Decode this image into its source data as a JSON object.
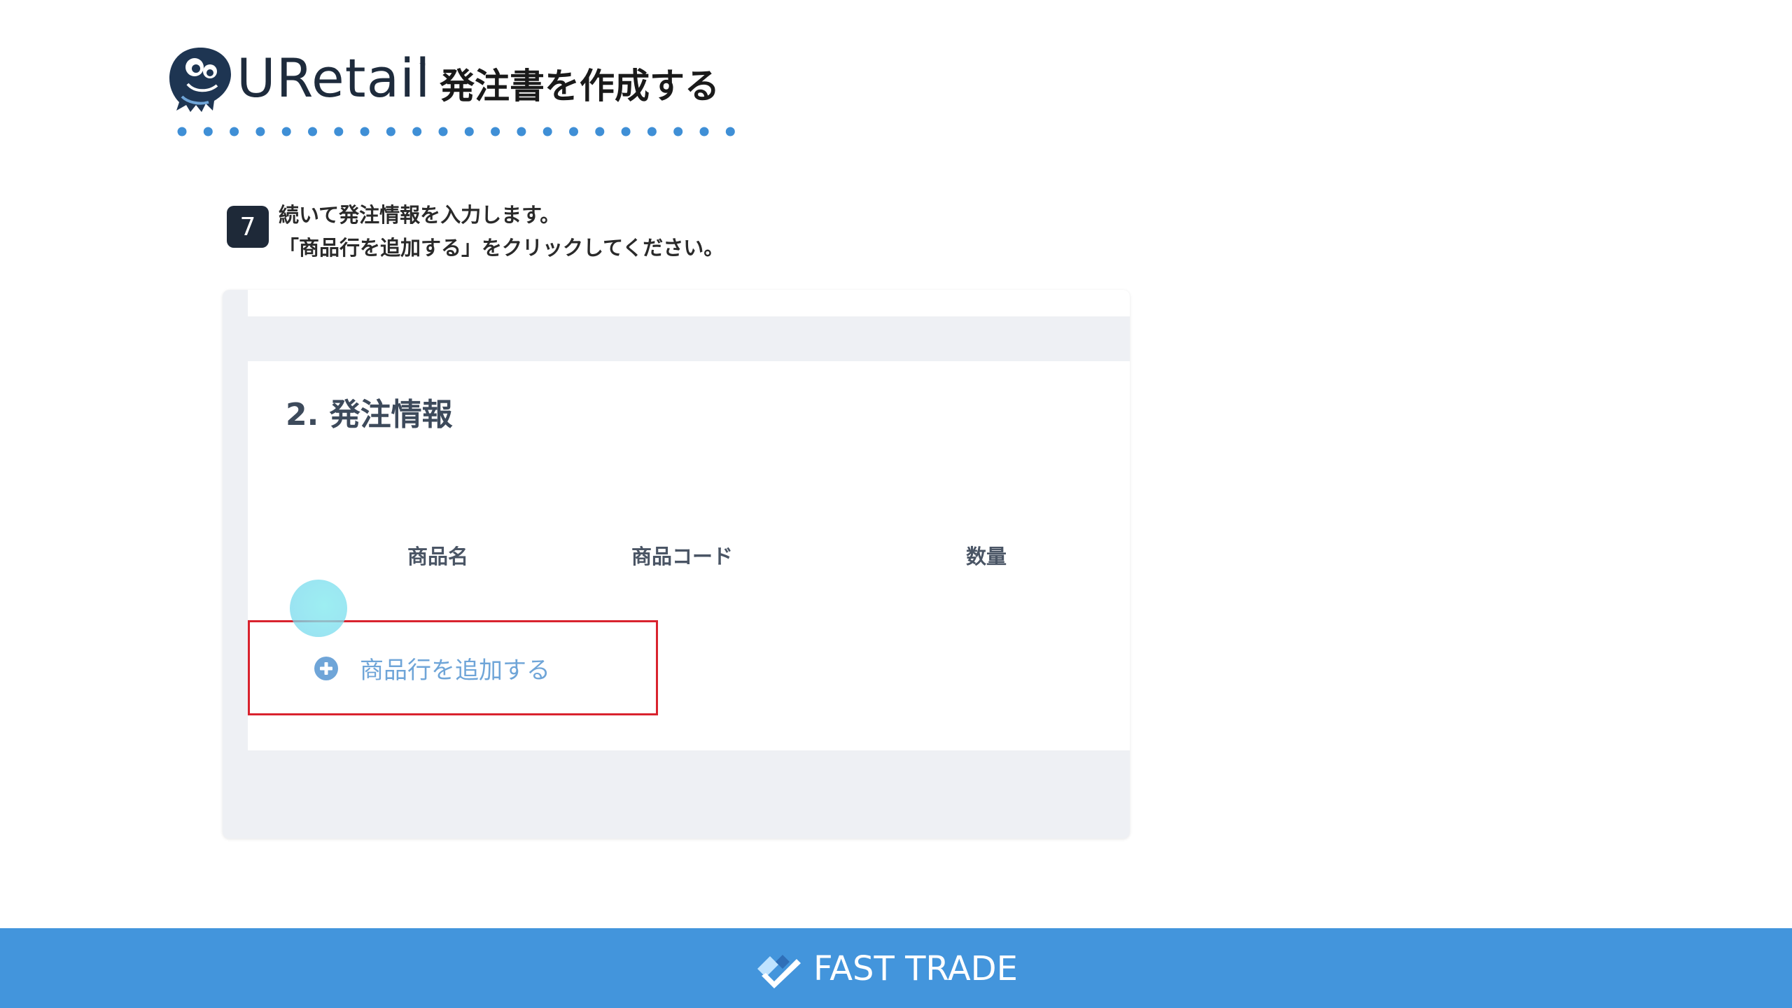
{
  "header": {
    "logo_text": "URetail",
    "logo_tm": "™",
    "title": "発注書を作成する"
  },
  "step": {
    "number": "7",
    "line1": "続いて発注情報を入力します。",
    "line2": "「商品行を追加する」をクリックしてください。"
  },
  "screenshot": {
    "section_title": "2. 発注情報",
    "columns": [
      "商品名",
      "商品コード",
      "数量"
    ],
    "add_row_label": "商品行を追加する",
    "highlight_color": "#d9232e",
    "link_color": "#6fa5d8"
  },
  "footer": {
    "brand": "FAST TRADE",
    "background": "#4395dc"
  },
  "icons": {
    "logo": "octopus-logo-icon",
    "add": "plus-circle-icon",
    "footer": "fast-trade-logo-icon"
  }
}
